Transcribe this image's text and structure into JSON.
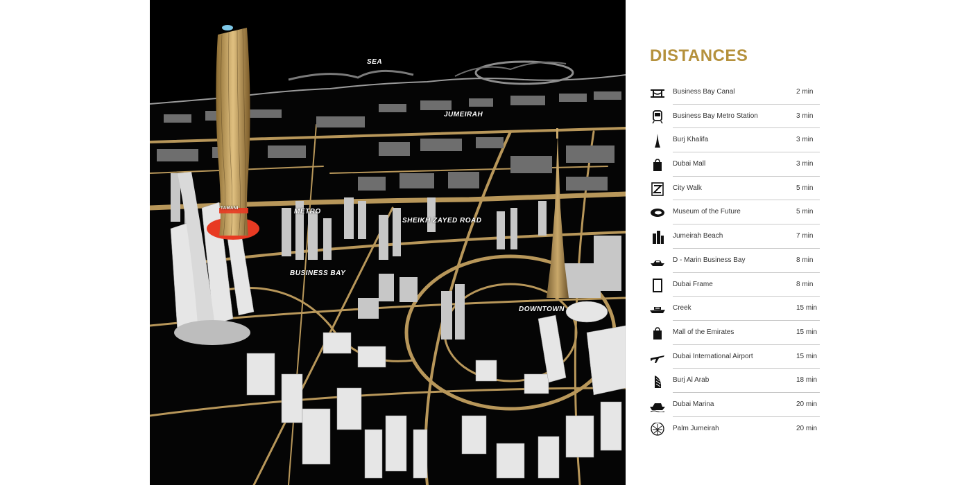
{
  "map": {
    "labels": {
      "sea": "SEA",
      "jumeirah": "JUMEIRAH",
      "metro": "METRO",
      "sheikh_zayed_road": "SHEIKH ZAYED ROAD",
      "business_bay": "BUSINESS BAY",
      "downtown": "DOWNTOWN"
    },
    "tower_sign": "TAMANI",
    "colors": {
      "background": "#050505",
      "roads": "#b8975a",
      "buildings": "#d9d9d9",
      "highlight": "#e83a22"
    }
  },
  "panel": {
    "title": "DISTANCES",
    "title_color": "#b5913c",
    "items": [
      {
        "icon": "bridge-icon",
        "place": "Business Bay Canal",
        "time": "2 min"
      },
      {
        "icon": "metro-train-icon",
        "place": "Business Bay Metro Station",
        "time": "3 min"
      },
      {
        "icon": "burj-khalifa-icon",
        "place": "Burj Khalifa",
        "time": "3 min"
      },
      {
        "icon": "shopping-bag-icon",
        "place": "Dubai Mall",
        "time": "3 min"
      },
      {
        "icon": "city-walk-icon",
        "place": "City Walk",
        "time": "5 min"
      },
      {
        "icon": "museum-future-icon",
        "place": "Museum of the Future",
        "time": "5 min"
      },
      {
        "icon": "buildings-icon",
        "place": "Jumeirah Beach",
        "time": "7  min"
      },
      {
        "icon": "yacht-icon",
        "place": "D - Marin Business Bay",
        "time": "8  min"
      },
      {
        "icon": "frame-icon",
        "place": "Dubai Frame",
        "time": "8  min"
      },
      {
        "icon": "boat-icon",
        "place": "Creek",
        "time": "15 min"
      },
      {
        "icon": "shopping-bag-icon",
        "place": "Mall of the Emirates",
        "time": "15 min"
      },
      {
        "icon": "airplane-icon",
        "place": "Dubai International Airport",
        "time": "15 min"
      },
      {
        "icon": "burj-al-arab-icon",
        "place": "Burj Al Arab",
        "time": "18 min"
      },
      {
        "icon": "ship-icon",
        "place": "Dubai Marina",
        "time": "20 min"
      },
      {
        "icon": "palm-tree-icon",
        "place": "Palm Jumeirah",
        "time": "20 min"
      }
    ]
  }
}
